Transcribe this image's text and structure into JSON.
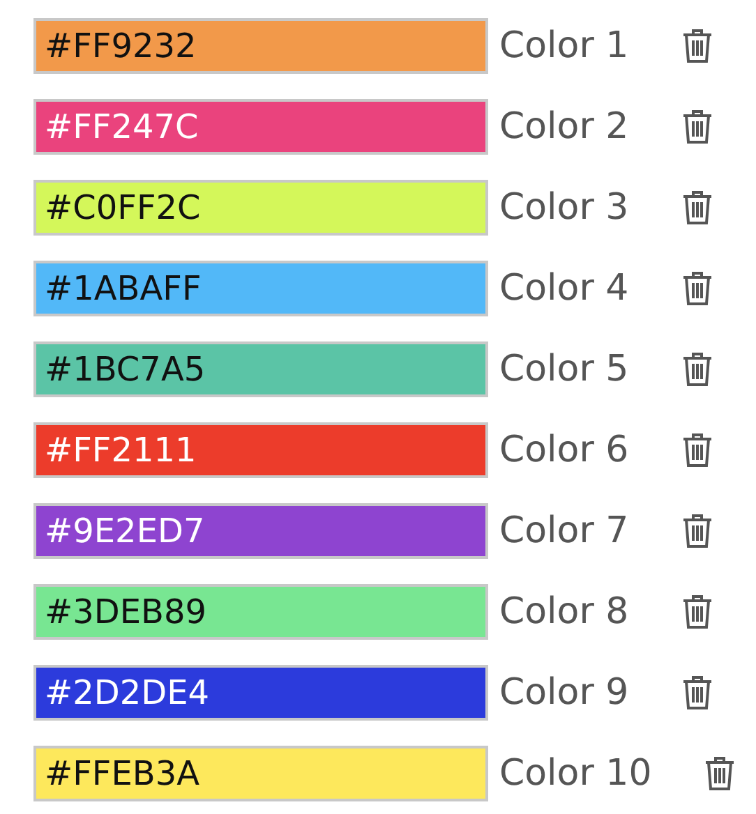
{
  "colors": [
    {
      "value": "#FF9232",
      "color": "#f2994a",
      "label": "Color 1"
    },
    {
      "value": "#FF247C",
      "color": "#ea437d",
      "label": "Color 2"
    },
    {
      "value": "#C0FF2C",
      "color": "#d4f75a",
      "label": "Color 3"
    },
    {
      "value": "#1ABAFF",
      "color": "#52b8f8",
      "label": "Color 4"
    },
    {
      "value": "#1BC7A5",
      "color": "#5bc4a6",
      "label": "Color 5"
    },
    {
      "value": "#FF2111",
      "color": "#ec3c2b",
      "label": "Color 6"
    },
    {
      "value": "#9E2ED7",
      "color": "#8e44d0",
      "label": "Color 7"
    },
    {
      "value": "#3DEB89",
      "color": "#78e692",
      "label": "Color 8"
    },
    {
      "value": "#2D2DE4",
      "color": "#2c3bdc",
      "label": "Color 9"
    },
    {
      "value": "#FFEB3A",
      "color": "#fde85c",
      "label": "Color 10"
    }
  ]
}
